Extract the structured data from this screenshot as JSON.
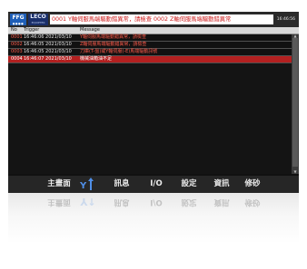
{
  "header": {
    "logo_main": "FFG",
    "logo_dots": "●●●●",
    "logo_brand": "LECO",
    "logo_brand_sub": "EQUIPTEK",
    "marquee": "0001 Y軸伺服馬端驅動錯異常，請檢查  0002 Z軸伺服馬端驅動錯異常",
    "clock": "16:46:56"
  },
  "alarm_table": {
    "headers": [
      "No",
      "Trigger",
      "Message"
    ],
    "rows": [
      {
        "no": "0001",
        "trigger": "16:46:06 2021/03/10",
        "message": "Y軸伺服馬端驅動錯異常，請檢查"
      },
      {
        "no": "0002",
        "trigger": "16:46:05 2021/03/10",
        "message": "Z軸伺服馬端驅動錯異常，請檢查"
      },
      {
        "no": "0003",
        "trigger": "16:46:05 2021/03/10",
        "message": "刀庫(T-盤)或Y軸伺服(-E)馬端驅動訊號"
      },
      {
        "no": "0004",
        "trigger": "16:46:07 2021/03/10",
        "message": "機械油箱油不足"
      }
    ]
  },
  "toolbar": {
    "items": [
      "主畫面",
      "訊息",
      "I/O",
      "設定",
      "資訊",
      "修砂"
    ],
    "axis_icon": "xy-axis-icon"
  },
  "colors": {
    "alarm_text": "#ff5a4a",
    "selected_row": "#b32020",
    "icon_blue": "#4f8ee6"
  }
}
